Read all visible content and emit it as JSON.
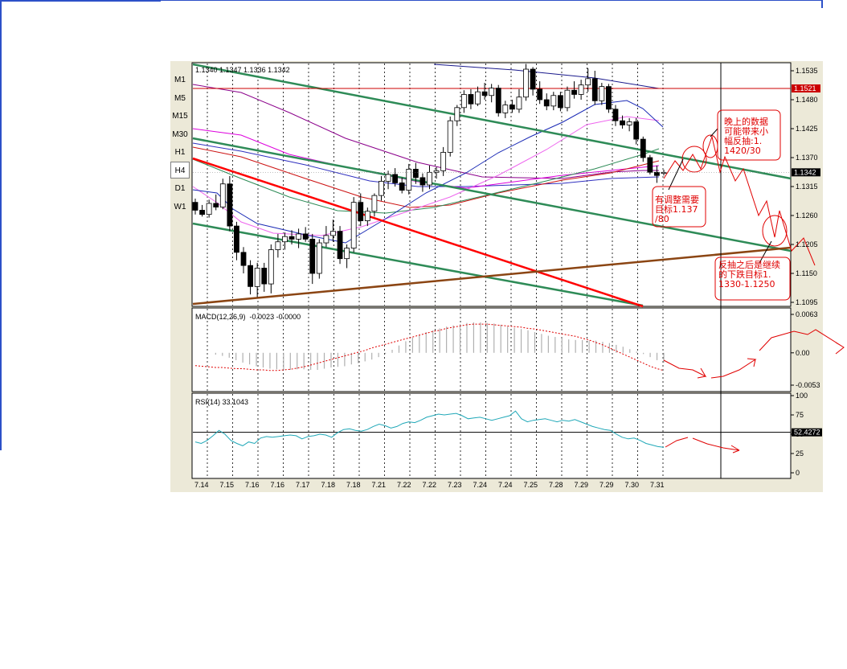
{
  "timeframes": [
    {
      "label": "M1",
      "active": false
    },
    {
      "label": "M5",
      "active": false
    },
    {
      "label": "M15",
      "active": false
    },
    {
      "label": "M30",
      "active": false
    },
    {
      "label": "H1",
      "active": false
    },
    {
      "label": "H4",
      "active": true
    },
    {
      "label": "D1",
      "active": false
    },
    {
      "label": "W1",
      "active": false
    }
  ],
  "chart_data": {
    "type": "candlestick",
    "ohlc_header": "1.1340 1.1347 1.1336 1.1342",
    "price_axis_labels": [
      "1.1535",
      "1.1480",
      "1.1425",
      "1.1370",
      "1.1315",
      "1.1260",
      "1.1205",
      "1.1150",
      "1.1095"
    ],
    "price_range": [
      1.1095,
      1.1535
    ],
    "resistance_label": "1.1521",
    "current_price_label": "1.1342",
    "date_labels": [
      "7.14",
      "7.15",
      "7.16",
      "7.16",
      "7.17",
      "7.18",
      "7.18",
      "7.21",
      "7.22",
      "7.22",
      "7.23",
      "7.24",
      "7.24",
      "7.25",
      "7.28",
      "7.29",
      "7.29",
      "7.30",
      "7.31"
    ],
    "candles": [
      [
        1.1285,
        1.1292,
        1.1262,
        1.127
      ],
      [
        1.127,
        1.128,
        1.1258,
        1.1262
      ],
      [
        1.1262,
        1.129,
        1.1256,
        1.1283
      ],
      [
        1.1283,
        1.13,
        1.127,
        1.1276
      ],
      [
        1.1276,
        1.133,
        1.1272,
        1.132
      ],
      [
        1.132,
        1.1335,
        1.123,
        1.124
      ],
      [
        1.124,
        1.1248,
        1.1175,
        1.119
      ],
      [
        1.119,
        1.12,
        1.115,
        1.1165
      ],
      [
        1.1165,
        1.1175,
        1.111,
        1.1125
      ],
      [
        1.1125,
        1.117,
        1.1105,
        1.116
      ],
      [
        1.116,
        1.117,
        1.1115,
        1.113
      ],
      [
        1.113,
        1.1205,
        1.1112,
        1.1195
      ],
      [
        1.1195,
        1.1225,
        1.118,
        1.121
      ],
      [
        1.121,
        1.1228,
        1.1195,
        1.122
      ],
      [
        1.122,
        1.1232,
        1.1205,
        1.1215
      ],
      [
        1.1215,
        1.1235,
        1.1198,
        1.1225
      ],
      [
        1.1225,
        1.1238,
        1.121,
        1.1215
      ],
      [
        1.1215,
        1.1225,
        1.113,
        1.115
      ],
      [
        1.115,
        1.1215,
        1.114,
        1.1208
      ],
      [
        1.1208,
        1.124,
        1.12,
        1.1222
      ],
      [
        1.1222,
        1.1252,
        1.121,
        1.123
      ],
      [
        1.123,
        1.124,
        1.1168,
        1.1178
      ],
      [
        1.1178,
        1.1205,
        1.116,
        1.1198
      ],
      [
        1.1198,
        1.1295,
        1.119,
        1.1285
      ],
      [
        1.1285,
        1.1302,
        1.124,
        1.125
      ],
      [
        1.125,
        1.1275,
        1.124,
        1.1268
      ],
      [
        1.1268,
        1.1302,
        1.1258,
        1.1298
      ],
      [
        1.1298,
        1.1335,
        1.1288,
        1.1325
      ],
      [
        1.1325,
        1.1345,
        1.131,
        1.1338
      ],
      [
        1.1338,
        1.135,
        1.1315,
        1.1322
      ],
      [
        1.1322,
        1.1332,
        1.1302,
        1.1308
      ],
      [
        1.1308,
        1.1358,
        1.13,
        1.1348
      ],
      [
        1.1348,
        1.136,
        1.132,
        1.1332
      ],
      [
        1.1332,
        1.134,
        1.1305,
        1.1318
      ],
      [
        1.1318,
        1.1355,
        1.131,
        1.1342
      ],
      [
        1.1342,
        1.1352,
        1.133,
        1.1345
      ],
      [
        1.1345,
        1.139,
        1.1335,
        1.138
      ],
      [
        1.138,
        1.1448,
        1.1372,
        1.144
      ],
      [
        1.144,
        1.147,
        1.143,
        1.1465
      ],
      [
        1.1465,
        1.1498,
        1.1455,
        1.149
      ],
      [
        1.149,
        1.15,
        1.1462,
        1.1472
      ],
      [
        1.1472,
        1.1505,
        1.1468,
        1.1495
      ],
      [
        1.1495,
        1.1512,
        1.148,
        1.1488
      ],
      [
        1.1488,
        1.151,
        1.1475,
        1.1502
      ],
      [
        1.1502,
        1.1508,
        1.1448,
        1.1455
      ],
      [
        1.1455,
        1.1478,
        1.1445,
        1.147
      ],
      [
        1.147,
        1.148,
        1.1455,
        1.1462
      ],
      [
        1.1462,
        1.15,
        1.1455,
        1.1485
      ],
      [
        1.1485,
        1.1548,
        1.1478,
        1.1538
      ],
      [
        1.1538,
        1.1542,
        1.1488,
        1.15
      ],
      [
        1.15,
        1.1515,
        1.1472,
        1.148
      ],
      [
        1.148,
        1.1492,
        1.146,
        1.1468
      ],
      [
        1.1468,
        1.1495,
        1.146,
        1.1488
      ],
      [
        1.1488,
        1.1495,
        1.1458,
        1.1465
      ],
      [
        1.1465,
        1.1505,
        1.1458,
        1.1498
      ],
      [
        1.1498,
        1.1515,
        1.1482,
        1.149
      ],
      [
        1.149,
        1.1518,
        1.148,
        1.1508
      ],
      [
        1.1508,
        1.154,
        1.1495,
        1.152
      ],
      [
        1.152,
        1.1535,
        1.147,
        1.1478
      ],
      [
        1.1478,
        1.1512,
        1.147,
        1.1505
      ],
      [
        1.1505,
        1.151,
        1.1455,
        1.1462
      ],
      [
        1.1462,
        1.147,
        1.143,
        1.144
      ],
      [
        1.144,
        1.145,
        1.1425,
        1.1432
      ],
      [
        1.1432,
        1.1445,
        1.142,
        1.1438
      ],
      [
        1.1438,
        1.1445,
        1.1395,
        1.1405
      ],
      [
        1.1405,
        1.141,
        1.1362,
        1.137
      ],
      [
        1.137,
        1.1375,
        1.1338,
        1.1342
      ],
      [
        1.1342,
        1.1355,
        1.1322,
        1.1336
      ],
      [
        1.134,
        1.1347,
        1.1336,
        1.1342
      ]
    ],
    "macd": {
      "label": "MACD(12,26,9)",
      "values": "-0.0023 -0.0000",
      "axis_labels": [
        "0.0063",
        "0.00",
        "-0.0053"
      ],
      "range": [
        -0.0053,
        0.0063
      ],
      "histogram": [
        0.0,
        0.0,
        0.0,
        -0.0003,
        -0.0005,
        -0.0008,
        -0.0012,
        -0.0016,
        -0.0019,
        -0.0022,
        -0.0024,
        -0.0026,
        -0.0027,
        -0.0028,
        -0.0028,
        -0.0027,
        -0.0027,
        -0.0028,
        -0.0028,
        -0.0026,
        -0.0024,
        -0.0023,
        -0.0022,
        -0.0019,
        -0.0017,
        -0.0014,
        -0.0011,
        -0.0007,
        -0.0002,
        0.0005,
        0.0012,
        0.0019,
        0.0025,
        0.003,
        0.0034,
        0.0037,
        0.004,
        0.0043,
        0.0045,
        0.0047,
        0.0049,
        0.005,
        0.005,
        0.0049,
        0.0048,
        0.0046,
        0.0043,
        0.0041,
        0.0039,
        0.0037,
        0.0034,
        0.0031,
        0.0028,
        0.0026,
        0.0024,
        0.0022,
        0.0021,
        0.0021,
        0.002,
        0.002,
        0.0018,
        0.0016,
        0.0013,
        0.001,
        0.0006,
        0.0002,
        -0.0002,
        -0.0007,
        -0.0012,
        -0.0016
      ],
      "signal": [
        -0.0021,
        -0.0022,
        -0.0023,
        -0.0024,
        -0.0024,
        -0.0025,
        -0.0026,
        -0.0026,
        -0.0027,
        -0.0028,
        -0.0028,
        -0.0029,
        -0.0029,
        -0.0028,
        -0.0027,
        -0.0025,
        -0.0023,
        -0.002,
        -0.0017,
        -0.0014,
        -0.0011,
        -0.0008,
        -0.0005,
        -0.0002,
        0.0001,
        0.0004,
        0.0008,
        0.0011,
        0.0014,
        0.0017,
        0.002,
        0.0023,
        0.0026,
        0.0029,
        0.0032,
        0.0035,
        0.0037,
        0.004,
        0.0042,
        0.0044,
        0.0046,
        0.0047,
        0.0047,
        0.0047,
        0.0046,
        0.0045,
        0.0044,
        0.0043,
        0.0042,
        0.004,
        0.0039,
        0.0037,
        0.0035,
        0.0033,
        0.0031,
        0.0029,
        0.0027,
        0.0024,
        0.0021,
        0.0017,
        0.0013,
        0.0008,
        0.0003,
        -0.0002,
        -0.0007,
        -0.0012,
        -0.0017,
        -0.0022,
        -0.0026,
        -0.0029
      ]
    },
    "rsi": {
      "label": "RSI(14)",
      "value": "33.1043",
      "axis_labels": [
        "100",
        "75",
        "50",
        "25",
        "0"
      ],
      "level_label": "52.4272",
      "range": [
        0,
        100
      ],
      "values": [
        40,
        38,
        42,
        48,
        55,
        50,
        42,
        38,
        35,
        40,
        38,
        45,
        47,
        46,
        47,
        48,
        49,
        48,
        44,
        47,
        48,
        50,
        49,
        46,
        52,
        56,
        57,
        55,
        54,
        56,
        60,
        63,
        61,
        58,
        60,
        64,
        66,
        65,
        68,
        72,
        74,
        76,
        75,
        76,
        77,
        74,
        70,
        71,
        72,
        70,
        68,
        70,
        72,
        74,
        80,
        70,
        66,
        68,
        69,
        70,
        68,
        66,
        68,
        67,
        69,
        66,
        63,
        60,
        58,
        56,
        55,
        50,
        46,
        44,
        45,
        42,
        38,
        36,
        34,
        33
      ]
    },
    "annotations": [
      "有调整需要\n目标1.137\n/80",
      "晚上的数据\n可能带来小\n幅反抽:1.\n1420/30",
      "反抽之后是继续\n的下跌目标1.\n1330-1.1250"
    ]
  }
}
